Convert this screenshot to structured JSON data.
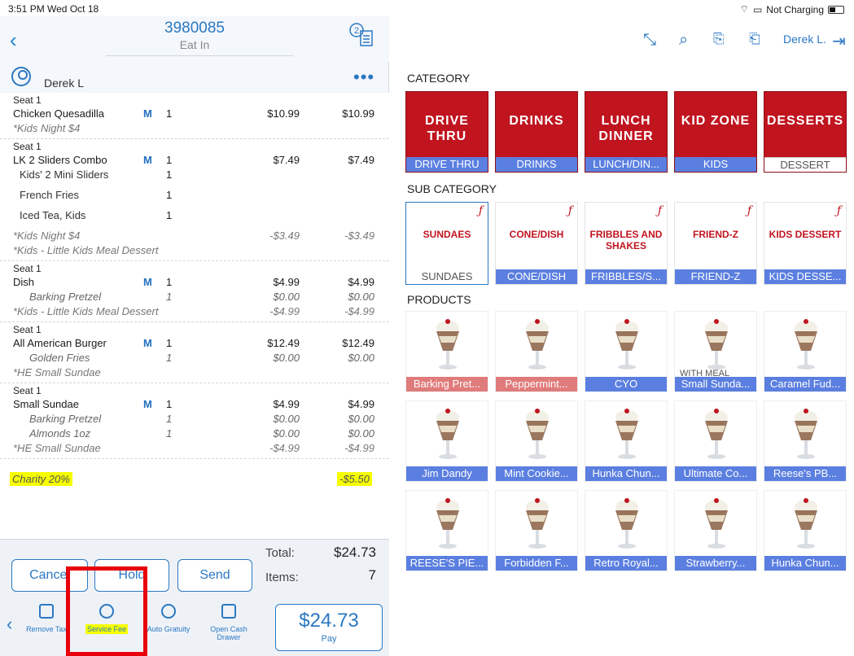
{
  "status": {
    "time": "3:51 PM  Wed Oct 18",
    "charging": "Not Charging"
  },
  "order": {
    "number": "3980085",
    "type": "Eat In",
    "badge": "2",
    "customer": "Derek L"
  },
  "seats": [
    {
      "label": "Seat 1",
      "rows": [
        {
          "kind": "item",
          "name": "Chicken Quesadilla",
          "m": "M",
          "qty": "1",
          "price": "$10.99",
          "total": "$10.99"
        },
        {
          "kind": "note",
          "name": "*Kids Night $4",
          "qty": "",
          "price": "",
          "total": ""
        }
      ]
    },
    {
      "label": "Seat 1",
      "rows": [
        {
          "kind": "item",
          "name": "LK 2 Sliders Combo",
          "m": "M",
          "qty": "1",
          "price": "$7.49",
          "total": "$7.49"
        },
        {
          "kind": "combo",
          "name": "Kids' 2 Mini Sliders",
          "qty": "1",
          "price": "",
          "total": ""
        },
        {
          "kind": "combo",
          "name": "French Fries",
          "qty": "1",
          "price": "",
          "total": ""
        },
        {
          "kind": "combo",
          "name": "Iced Tea, Kids",
          "qty": "1",
          "price": "",
          "total": ""
        },
        {
          "kind": "note",
          "name": "*Kids Night $4",
          "qty": "",
          "price": "-$3.49",
          "total": "-$3.49"
        },
        {
          "kind": "note",
          "name": "*Kids - Little Kids Meal Dessert",
          "qty": "",
          "price": "",
          "total": ""
        }
      ]
    },
    {
      "label": "Seat 1",
      "rows": [
        {
          "kind": "item",
          "name": "Dish",
          "m": "M",
          "qty": "1",
          "price": "$4.99",
          "total": "$4.99"
        },
        {
          "kind": "mod",
          "name": "Barking Pretzel",
          "qty": "1",
          "price": "$0.00",
          "total": "$0.00"
        },
        {
          "kind": "note",
          "name": "*Kids - Little Kids Meal Dessert",
          "qty": "",
          "price": "-$4.99",
          "total": "-$4.99"
        }
      ]
    },
    {
      "label": "Seat 1",
      "rows": [
        {
          "kind": "item",
          "name": "All American Burger",
          "m": "M",
          "qty": "1",
          "price": "$12.49",
          "total": "$12.49"
        },
        {
          "kind": "mod",
          "name": "Golden Fries",
          "qty": "1",
          "price": "$0.00",
          "total": "$0.00"
        },
        {
          "kind": "note",
          "name": "*HE Small Sundae",
          "qty": "",
          "price": "",
          "total": ""
        }
      ]
    },
    {
      "label": "Seat 1",
      "rows": [
        {
          "kind": "item",
          "name": "Small Sundae",
          "m": "M",
          "qty": "1",
          "price": "$4.99",
          "total": "$4.99"
        },
        {
          "kind": "mod",
          "name": "Barking Pretzel",
          "qty": "1",
          "price": "$0.00",
          "total": "$0.00"
        },
        {
          "kind": "mod",
          "name": "Almonds 1oz",
          "qty": "1",
          "price": "$0.00",
          "total": "$0.00"
        },
        {
          "kind": "note",
          "name": "*HE Small Sundae",
          "qty": "",
          "price": "-$4.99",
          "total": "-$4.99"
        }
      ]
    }
  ],
  "charity": {
    "label": "Charity 20%",
    "amount": "-$5.50"
  },
  "actions": {
    "cancel": "Cancel",
    "hold": "Hold",
    "send": "Send"
  },
  "totals": {
    "total_label": "Total:",
    "total_value": "$24.73",
    "items_label": "Items:",
    "items_value": "7"
  },
  "toolbar": {
    "remove_tax": "Remove Tax",
    "service_fee": "Service Fee",
    "auto_gratuity": "Auto Gratuity",
    "open_cash_drawer": "Open Cash Drawer",
    "pay_amount": "$24.73",
    "pay_label": "Pay"
  },
  "user": {
    "name": "Derek L."
  },
  "sections": {
    "category": "CATEGORY",
    "sub_category": "SUB CATEGORY",
    "products": "PRODUCTS"
  },
  "categories": [
    {
      "tile": "DRIVE THRU",
      "bar": "DRIVE THRU"
    },
    {
      "tile": "DRINKS",
      "bar": "DRINKS"
    },
    {
      "tile": "LUNCH DINNER",
      "bar": "LUNCH/DIN..."
    },
    {
      "tile": "KID ZONE",
      "bar": "KIDS"
    },
    {
      "tile": "DESSERTS",
      "bar": "DESSERT"
    }
  ],
  "sub_categories": [
    {
      "tile": "SUNDAES",
      "bar": "SUNDAES"
    },
    {
      "tile": "CONE/DISH",
      "bar": "CONE/DISH"
    },
    {
      "tile": "FRIBBLES AND SHAKES",
      "bar": "FRIBBLES/S..."
    },
    {
      "tile": "FRIEND-Z",
      "bar": "FRIEND-Z"
    },
    {
      "tile": "KIDS DESSERT",
      "bar": "KIDS DESSE..."
    }
  ],
  "products": [
    {
      "name": "Barking Pret...",
      "color": "#e07b7b"
    },
    {
      "name": "Peppermint...",
      "color": "#e07b7b"
    },
    {
      "name": "CYO",
      "color": "#5b7fe0"
    },
    {
      "name": "Small Sunda...",
      "color": "#5b7fe0",
      "sub": "WITH MEAL"
    },
    {
      "name": "Caramel Fud...",
      "color": "#5b7fe0"
    },
    {
      "name": "Jim Dandy",
      "color": "#5b7fe0"
    },
    {
      "name": "Mint Cookie...",
      "color": "#5b7fe0"
    },
    {
      "name": "Hunka Chun...",
      "color": "#5b7fe0"
    },
    {
      "name": "Ultimate Co...",
      "color": "#5b7fe0"
    },
    {
      "name": "Reese's PB...",
      "color": "#5b7fe0"
    },
    {
      "name": "REESE'S PIE...",
      "color": "#5b7fe0"
    },
    {
      "name": "Forbidden F...",
      "color": "#5b7fe0"
    },
    {
      "name": "Retro Royal...",
      "color": "#5b7fe0"
    },
    {
      "name": "Strawberry...",
      "color": "#5b7fe0"
    },
    {
      "name": "Hunka Chun...",
      "color": "#5b7fe0"
    }
  ],
  "colors": {
    "accent": "#2b78c2",
    "category_red": "#c0141f",
    "highlight": "#f6ff00",
    "annotation": "#e8000b"
  }
}
